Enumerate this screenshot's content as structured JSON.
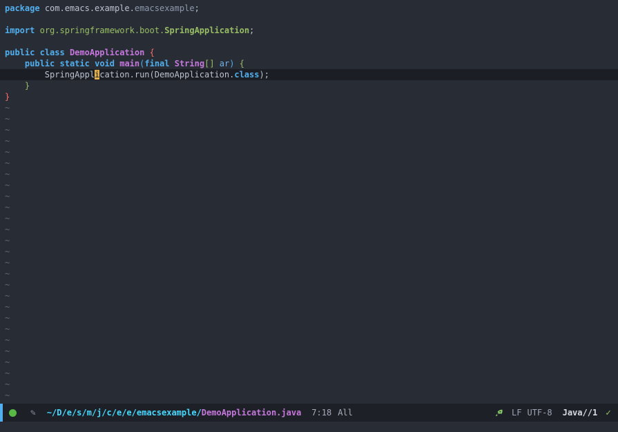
{
  "theme": {
    "palette": {
      "bg": "#282c34",
      "fg": "#bbc2cf",
      "hl": "#1b1e24",
      "blue": "#51afef",
      "green": "#98be65",
      "magenta": "#c678dd",
      "red": "#ff6c6b",
      "arg": "#73b3e7",
      "const": "#8e99ae",
      "cyan": "#46D9FF",
      "cursor": "#e2b04a",
      "tilde": "#5f6671",
      "dot": "#57b846",
      "ml-bg": "#1d2027",
      "ml-fg": "#9da5b4",
      "check": "#98be65",
      "rocket": "#86c766"
    }
  },
  "icons": {
    "pencil": "✎",
    "check": "✓",
    "rocket": "rocket-icon"
  },
  "editor": {
    "empty_line_marker": "~",
    "empty_line_count": 27,
    "lines": [
      {
        "segments": [
          {
            "t": "package",
            "s": "kw"
          },
          {
            "t": " ",
            "s": "pl"
          },
          {
            "t": "com.emacs.example.",
            "s": "pl"
          },
          {
            "t": "emacsexample",
            "s": "const"
          },
          {
            "t": ";",
            "s": "pl"
          }
        ]
      },
      {
        "segments": []
      },
      {
        "segments": [
          {
            "t": "import",
            "s": "kw"
          },
          {
            "t": " ",
            "s": "pl"
          },
          {
            "t": "org.springframework.boot.",
            "s": "green"
          },
          {
            "t": "SpringApplication",
            "s": "greenb"
          },
          {
            "t": ";",
            "s": "pl"
          }
        ]
      },
      {
        "segments": []
      },
      {
        "segments": [
          {
            "t": "public",
            "s": "kw"
          },
          {
            "t": " ",
            "s": "pl"
          },
          {
            "t": "class",
            "s": "kw"
          },
          {
            "t": " ",
            "s": "pl"
          },
          {
            "t": "DemoApplication",
            "s": "type"
          },
          {
            "t": " ",
            "s": "pl"
          },
          {
            "t": "{",
            "s": "dred"
          }
        ]
      },
      {
        "segments": [
          {
            "t": "    ",
            "s": "pl"
          },
          {
            "t": "public",
            "s": "kw"
          },
          {
            "t": " ",
            "s": "pl"
          },
          {
            "t": "static",
            "s": "kw"
          },
          {
            "t": " ",
            "s": "pl"
          },
          {
            "t": "void",
            "s": "kw"
          },
          {
            "t": " ",
            "s": "pl"
          },
          {
            "t": "main",
            "s": "fn"
          },
          {
            "t": "(",
            "s": "dblue"
          },
          {
            "t": "final",
            "s": "kw"
          },
          {
            "t": " ",
            "s": "pl"
          },
          {
            "t": "String",
            "s": "type"
          },
          {
            "t": "[]",
            "s": "dgreen"
          },
          {
            "t": " ",
            "s": "pl"
          },
          {
            "t": "ar",
            "s": "arg"
          },
          {
            "t": ")",
            "s": "dblue"
          },
          {
            "t": " ",
            "s": "pl"
          },
          {
            "t": "{",
            "s": "dgreen"
          }
        ]
      },
      {
        "current": true,
        "segments": [
          {
            "t": "        ",
            "s": "pl"
          },
          {
            "t": "SpringAppl",
            "s": "pl"
          },
          {
            "t": "i",
            "s": "pl",
            "cursor": true
          },
          {
            "t": "cation.run(DemoApplication.",
            "s": "pl"
          },
          {
            "t": "class",
            "s": "kw"
          },
          {
            "t": ");",
            "s": "pl"
          }
        ]
      },
      {
        "segments": [
          {
            "t": "    ",
            "s": "pl"
          },
          {
            "t": "}",
            "s": "dgreen"
          }
        ]
      },
      {
        "segments": [
          {
            "t": "}",
            "s": "dred"
          }
        ]
      }
    ]
  },
  "modeline": {
    "directory": "~/D/e/s/m/j/c/e/e/emacsexample/",
    "filename": "DemoApplication.java",
    "position": "7:18",
    "scroll": "All",
    "eol": "LF",
    "encoding": "UTF-8",
    "mode": "Java//1"
  }
}
